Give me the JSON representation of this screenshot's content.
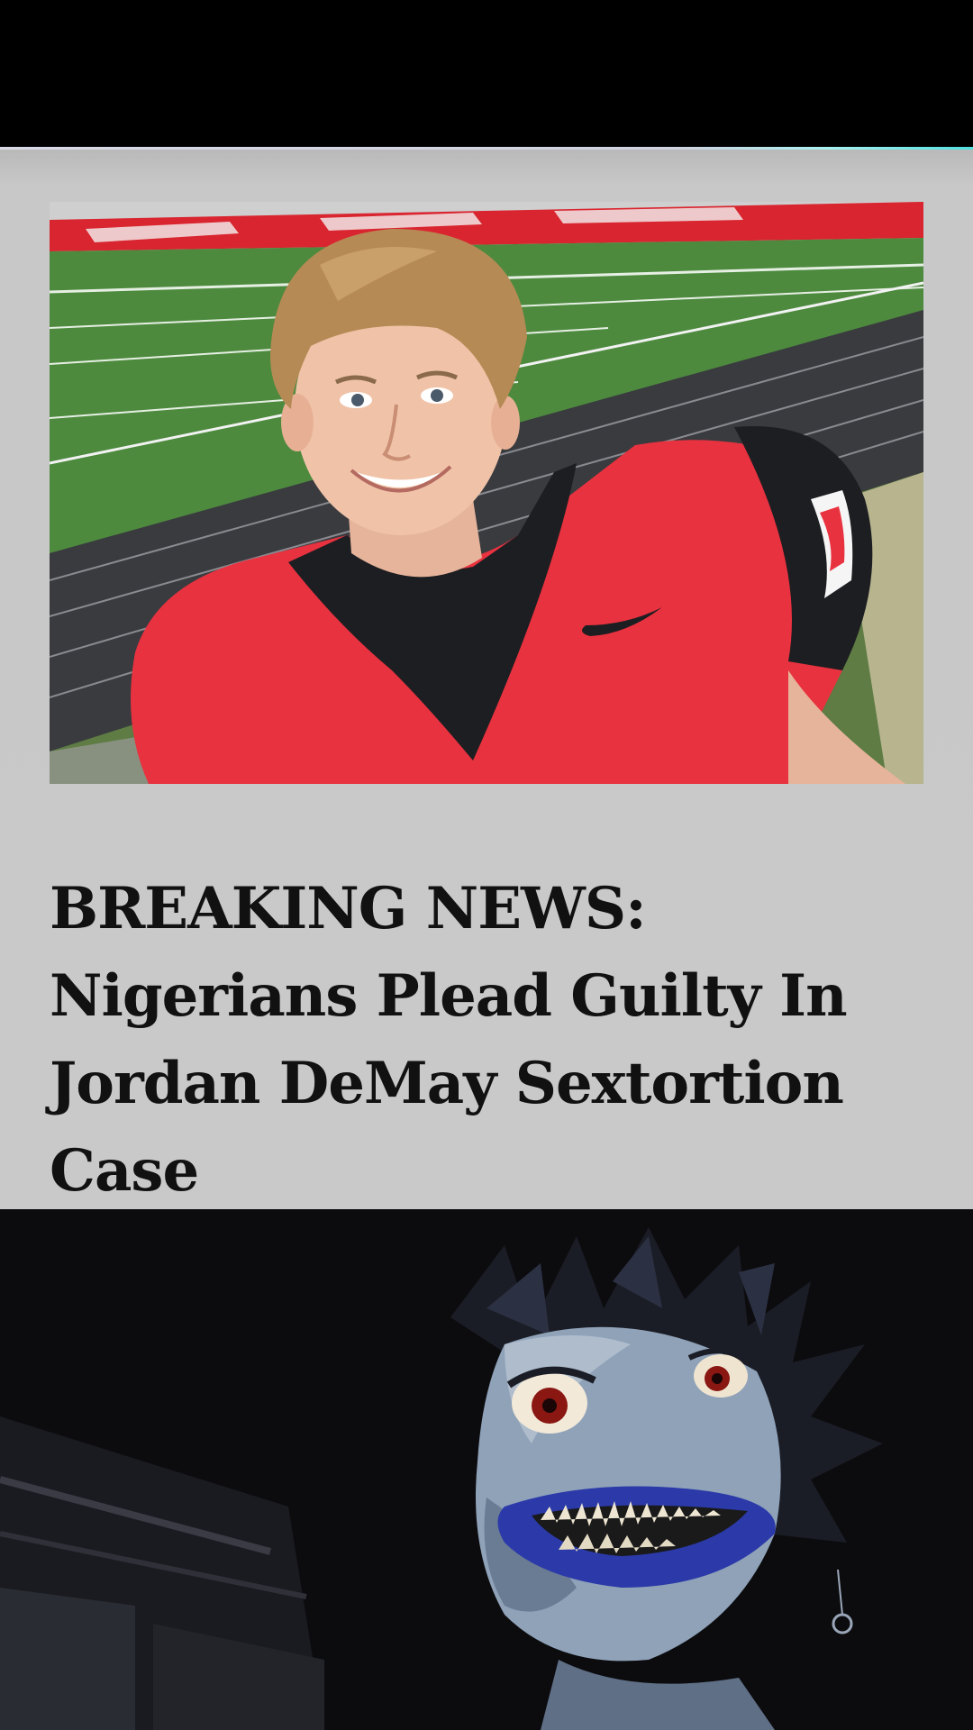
{
  "post": {
    "headline_lines": [
      "BREAKING NEWS:",
      "Nigerians Plead Guilty In",
      "Jordan DeMay Sextortion",
      "Case"
    ]
  },
  "images": {
    "news_photo": "teen-football-player-portrait",
    "reaction_still": "anime-shinigami-grinning"
  },
  "colors": {
    "card_background": "#c9c9c9",
    "headline_text": "#111111",
    "jersey_red": "#e8323f",
    "field_green": "#4d8a3e"
  }
}
